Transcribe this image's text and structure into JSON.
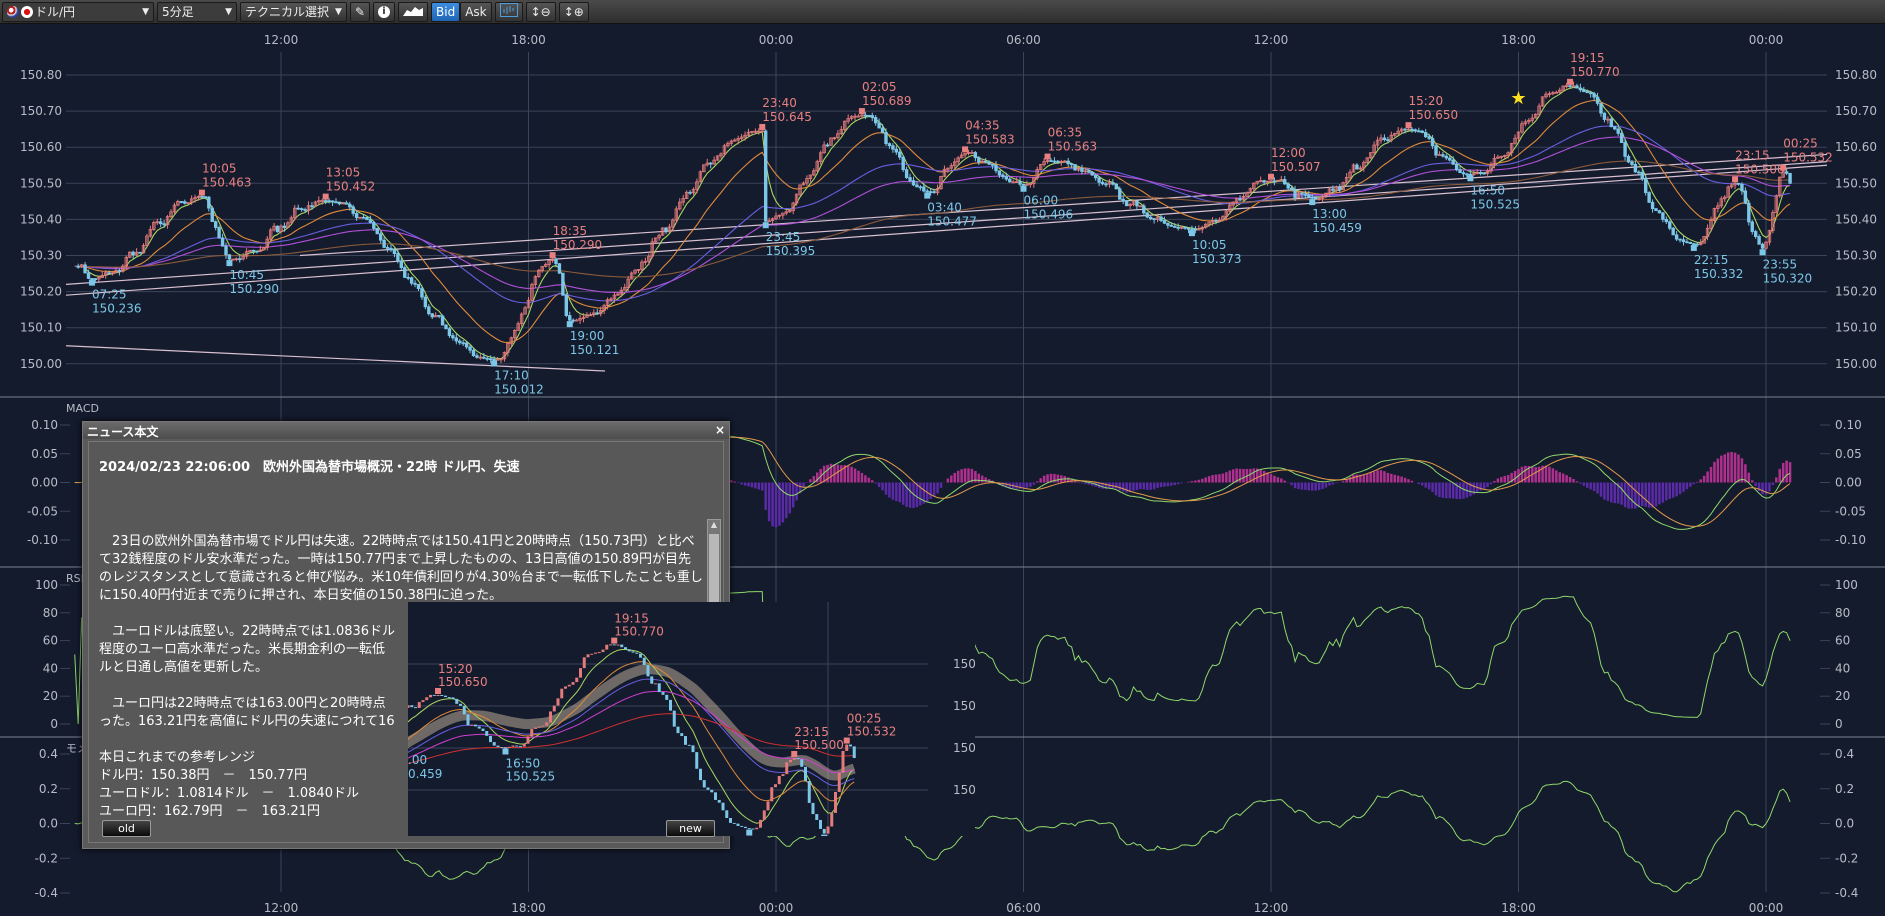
{
  "toolbar": {
    "pair": "ドル/円",
    "timeframe": "5分足",
    "technical": "テクニカル選択",
    "bid": "Bid",
    "ask": "Ask",
    "icons": [
      "us-flag-icon",
      "jp-flag-icon",
      "pencil-icon",
      "info-icon",
      "mountain-chart-icon",
      "chart-style-icon",
      "vertical-zoom-out-icon",
      "vertical-zoom-in-icon"
    ]
  },
  "colors": {
    "background": "#141b2d",
    "grid": "#3a4358",
    "up": "#e37b7b",
    "down": "#7cc7e8",
    "high_label": "#e88080",
    "low_label": "#7cc7e8",
    "macd": "#8fd86b",
    "signal": "#e39a4a",
    "hist_pos": "#b0308f",
    "hist_neg": "#5a2aa8",
    "accent": "#2f7bd0"
  },
  "chart_data": {
    "type": "candlestick",
    "timeframe": "5分足",
    "time_ticks": [
      "12:00",
      "18:00",
      "00:00",
      "06:00",
      "12:00",
      "18:00",
      "00:00"
    ],
    "price_ticks": [
      "150.80",
      "150.70",
      "150.60",
      "150.50",
      "150.40",
      "150.30",
      "150.20",
      "150.10",
      "150.00"
    ],
    "ylim": [
      149.92,
      150.87
    ],
    "start": {
      "time": "07:00",
      "price": 150.27
    },
    "end": {
      "time": "00:35",
      "price": 150.5
    },
    "extremes": [
      {
        "time": "07:25",
        "price": "150.236",
        "type": "low"
      },
      {
        "time": "10:05",
        "price": "150.463",
        "type": "high"
      },
      {
        "time": "10:45",
        "price": "150.290",
        "type": "low"
      },
      {
        "time": "13:05",
        "price": "150.452",
        "type": "high"
      },
      {
        "time": "17:10",
        "price": "150.012",
        "type": "low"
      },
      {
        "time": "18:35",
        "price": "150.290",
        "type": "high"
      },
      {
        "time": "19:00",
        "price": "150.121",
        "type": "low"
      },
      {
        "time": "23:40",
        "price": "150.645",
        "type": "high"
      },
      {
        "time": "23:45",
        "price": "150.395",
        "type": "low"
      },
      {
        "time": "02:05",
        "price": "150.689",
        "type": "high"
      },
      {
        "time": "03:40",
        "price": "150.477",
        "type": "low"
      },
      {
        "time": "04:35",
        "price": "150.583",
        "type": "high"
      },
      {
        "time": "06:00",
        "price": "150.496",
        "type": "low"
      },
      {
        "time": "06:35",
        "price": "150.563",
        "type": "high"
      },
      {
        "time": "10:05",
        "price": "150.373",
        "type": "low"
      },
      {
        "time": "12:00",
        "price": "150.507",
        "type": "high"
      },
      {
        "time": "13:00",
        "price": "150.459",
        "type": "low"
      },
      {
        "time": "15:20",
        "price": "150.650",
        "type": "high"
      },
      {
        "time": "16:50",
        "price": "150.525",
        "type": "low"
      },
      {
        "time": "19:15",
        "price": "150.770",
        "type": "high"
      },
      {
        "time": "22:15",
        "price": "150.332",
        "type": "low"
      },
      {
        "time": "23:15",
        "price": "150.500",
        "type": "high"
      },
      {
        "time": "23:55",
        "price": "150.320",
        "type": "low"
      },
      {
        "time": "00:25",
        "price": "150.532",
        "type": "high"
      }
    ],
    "panels": [
      {
        "label": "MACD",
        "ticks": [
          "0.10",
          "0.05",
          "0.00",
          "-0.05",
          "-0.10"
        ],
        "ylim": [
          -0.12,
          0.12
        ]
      },
      {
        "label": "RSI",
        "ticks": [
          "100",
          "80",
          "60",
          "40",
          "20",
          "0"
        ],
        "ylim": [
          0,
          100
        ]
      },
      {
        "label": "モメンタム",
        "ticks": [
          "0.4",
          "0.2",
          "0.0",
          "-0.2",
          "-0.4"
        ],
        "ylim": [
          -0.4,
          0.4
        ]
      }
    ]
  },
  "news": {
    "window_title": "ニュース本文",
    "close": "×",
    "headline": "2024/02/23 22:06:00　欧州外国為替市場概況・22時 ドル円、失速",
    "body": "　23日の欧州外国為替市場でドル円は失速。22時時点では150.41円と20時時点（150.73円）と比べて32銭程度のドル安水準だった。一時は150.77円まで上昇したものの、13日高値の150.89円が目先のレジスタンスとして意識されると伸び悩み。米10年債利回りが4.30％台まで一転低下したことも重しに150.40円付近まで売りに押され、本日安値の150.38円に迫った。\n\n　ユーロドルは底堅い。22時時点では1.0836ドル\n程度のユーロ高水準だった。米長期金利の一転低\nルと日通し高値を更新した。\n\n　ユーロ円は22時時点では163.00円と20時時点\nった。163.21円を高値にドル円の失速につれて16\n\n本日これまでの参考レンジ\nドル円：150.38円　－　150.77円\nユーロドル：1.0814ドル　－　1.0840ドル\nユーロ円：162.79円　－　163.21円",
    "old": "old",
    "new": "new",
    "thumbnail_labels": [
      {
        "time": "15:20",
        "price": "150.650",
        "type": "high"
      },
      {
        "time": "19:15",
        "price": "150.770",
        "type": "high"
      },
      {
        "time": "16:50",
        "price": "150.525",
        "type": "low"
      },
      {
        "time": "22:15",
        "price": "150.332",
        "type": "low"
      },
      {
        "time": "23:15",
        "price": "150.500",
        "type": "high"
      },
      {
        "time": "23:55",
        "price": "150.320",
        "type": "low"
      },
      {
        "time": "00:25",
        "price": "150.532",
        "type": "high"
      }
    ],
    "thumbnail_partial": [
      ".00",
      "0.459"
    ],
    "thumbnail_axis": [
      "150.",
      "150.",
      "150.",
      "150."
    ]
  }
}
